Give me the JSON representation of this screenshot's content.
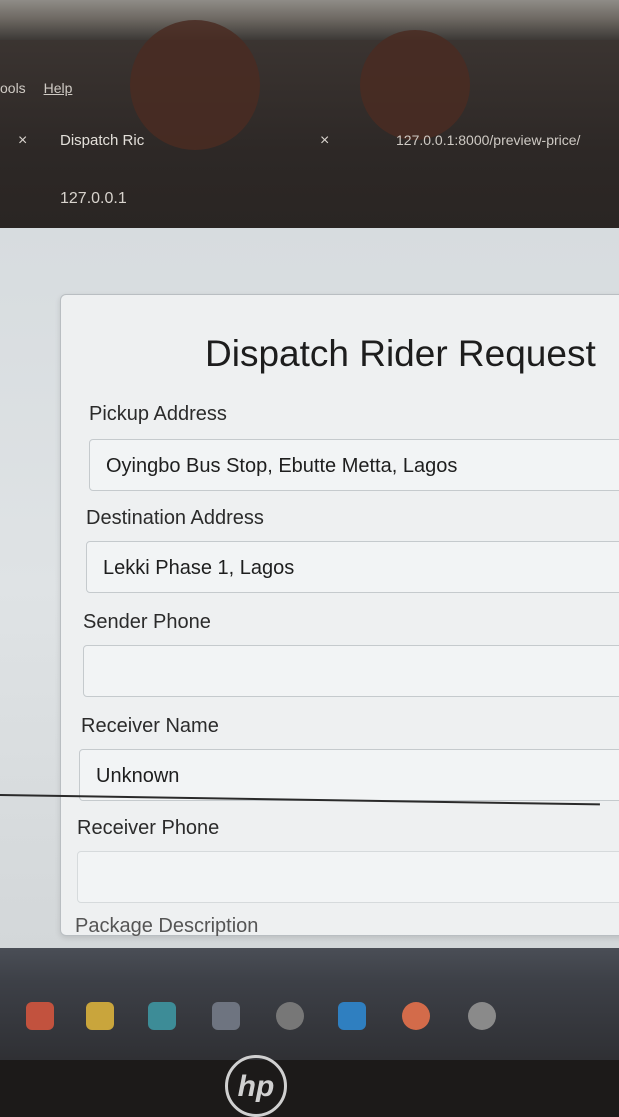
{
  "menu": {
    "tools": "ools",
    "help": "Help"
  },
  "tabs": [
    {
      "label": "Dispatch Ric"
    },
    {
      "label": "127.0.0.1:8000/preview-price/"
    }
  ],
  "address_bar": {
    "host": "127.0.0.1"
  },
  "form": {
    "title": "Dispatch Rider Request",
    "pickup_label": "Pickup Address",
    "pickup_value": "Oyingbo Bus Stop, Ebutte Metta, Lagos",
    "destination_label": "Destination Address",
    "destination_value": "Lekki Phase 1, Lagos",
    "sender_phone_label": "Sender Phone",
    "sender_phone_value": "",
    "receiver_name_label": "Receiver Name",
    "receiver_name_value": "Unknown",
    "receiver_phone_label": "Receiver Phone",
    "receiver_phone_value": "",
    "package_description_label": "Package Description"
  },
  "taskbar": {
    "icons": [
      "powerpoint-icon",
      "files-icon",
      "store-icon",
      "code-icon",
      "media-icon",
      "vscode-icon",
      "firefox-icon",
      "chrome-icon"
    ]
  },
  "device": {
    "brand": "hp"
  }
}
